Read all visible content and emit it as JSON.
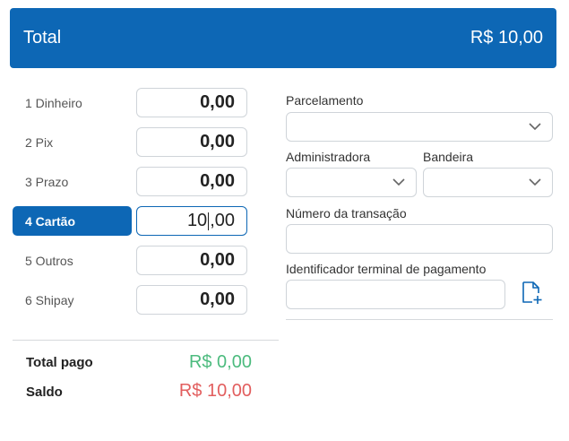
{
  "header": {
    "title": "Total",
    "amount": "R$ 10,00"
  },
  "methods": [
    {
      "label": "1 Dinheiro",
      "value": "0,00"
    },
    {
      "label": "2 Pix",
      "value": "0,00"
    },
    {
      "label": "3 Prazo",
      "value": "0,00"
    },
    {
      "label": "4 Cartão",
      "value_before_caret": "10",
      "value_after_caret": ",00"
    },
    {
      "label": "5 Outros",
      "value": "0,00"
    },
    {
      "label": "6 Shipay",
      "value": "0,00"
    }
  ],
  "summary": {
    "paid_label": "Total pago",
    "paid_value": "R$ 0,00",
    "balance_label": "Saldo",
    "balance_value": "R$ 10,00"
  },
  "card": {
    "installments_label": "Parcelamento",
    "administrator_label": "Administradora",
    "brand_label": "Bandeira",
    "transaction_label": "Número da transação",
    "terminal_label": "Identificador terminal de pagamento"
  },
  "icons": {
    "select": "chevron-down-icon",
    "file": "file-add-icon"
  },
  "colors": {
    "primary": "#0d67b5",
    "paid": "#4cbb7e",
    "balance": "#e25e5e"
  }
}
